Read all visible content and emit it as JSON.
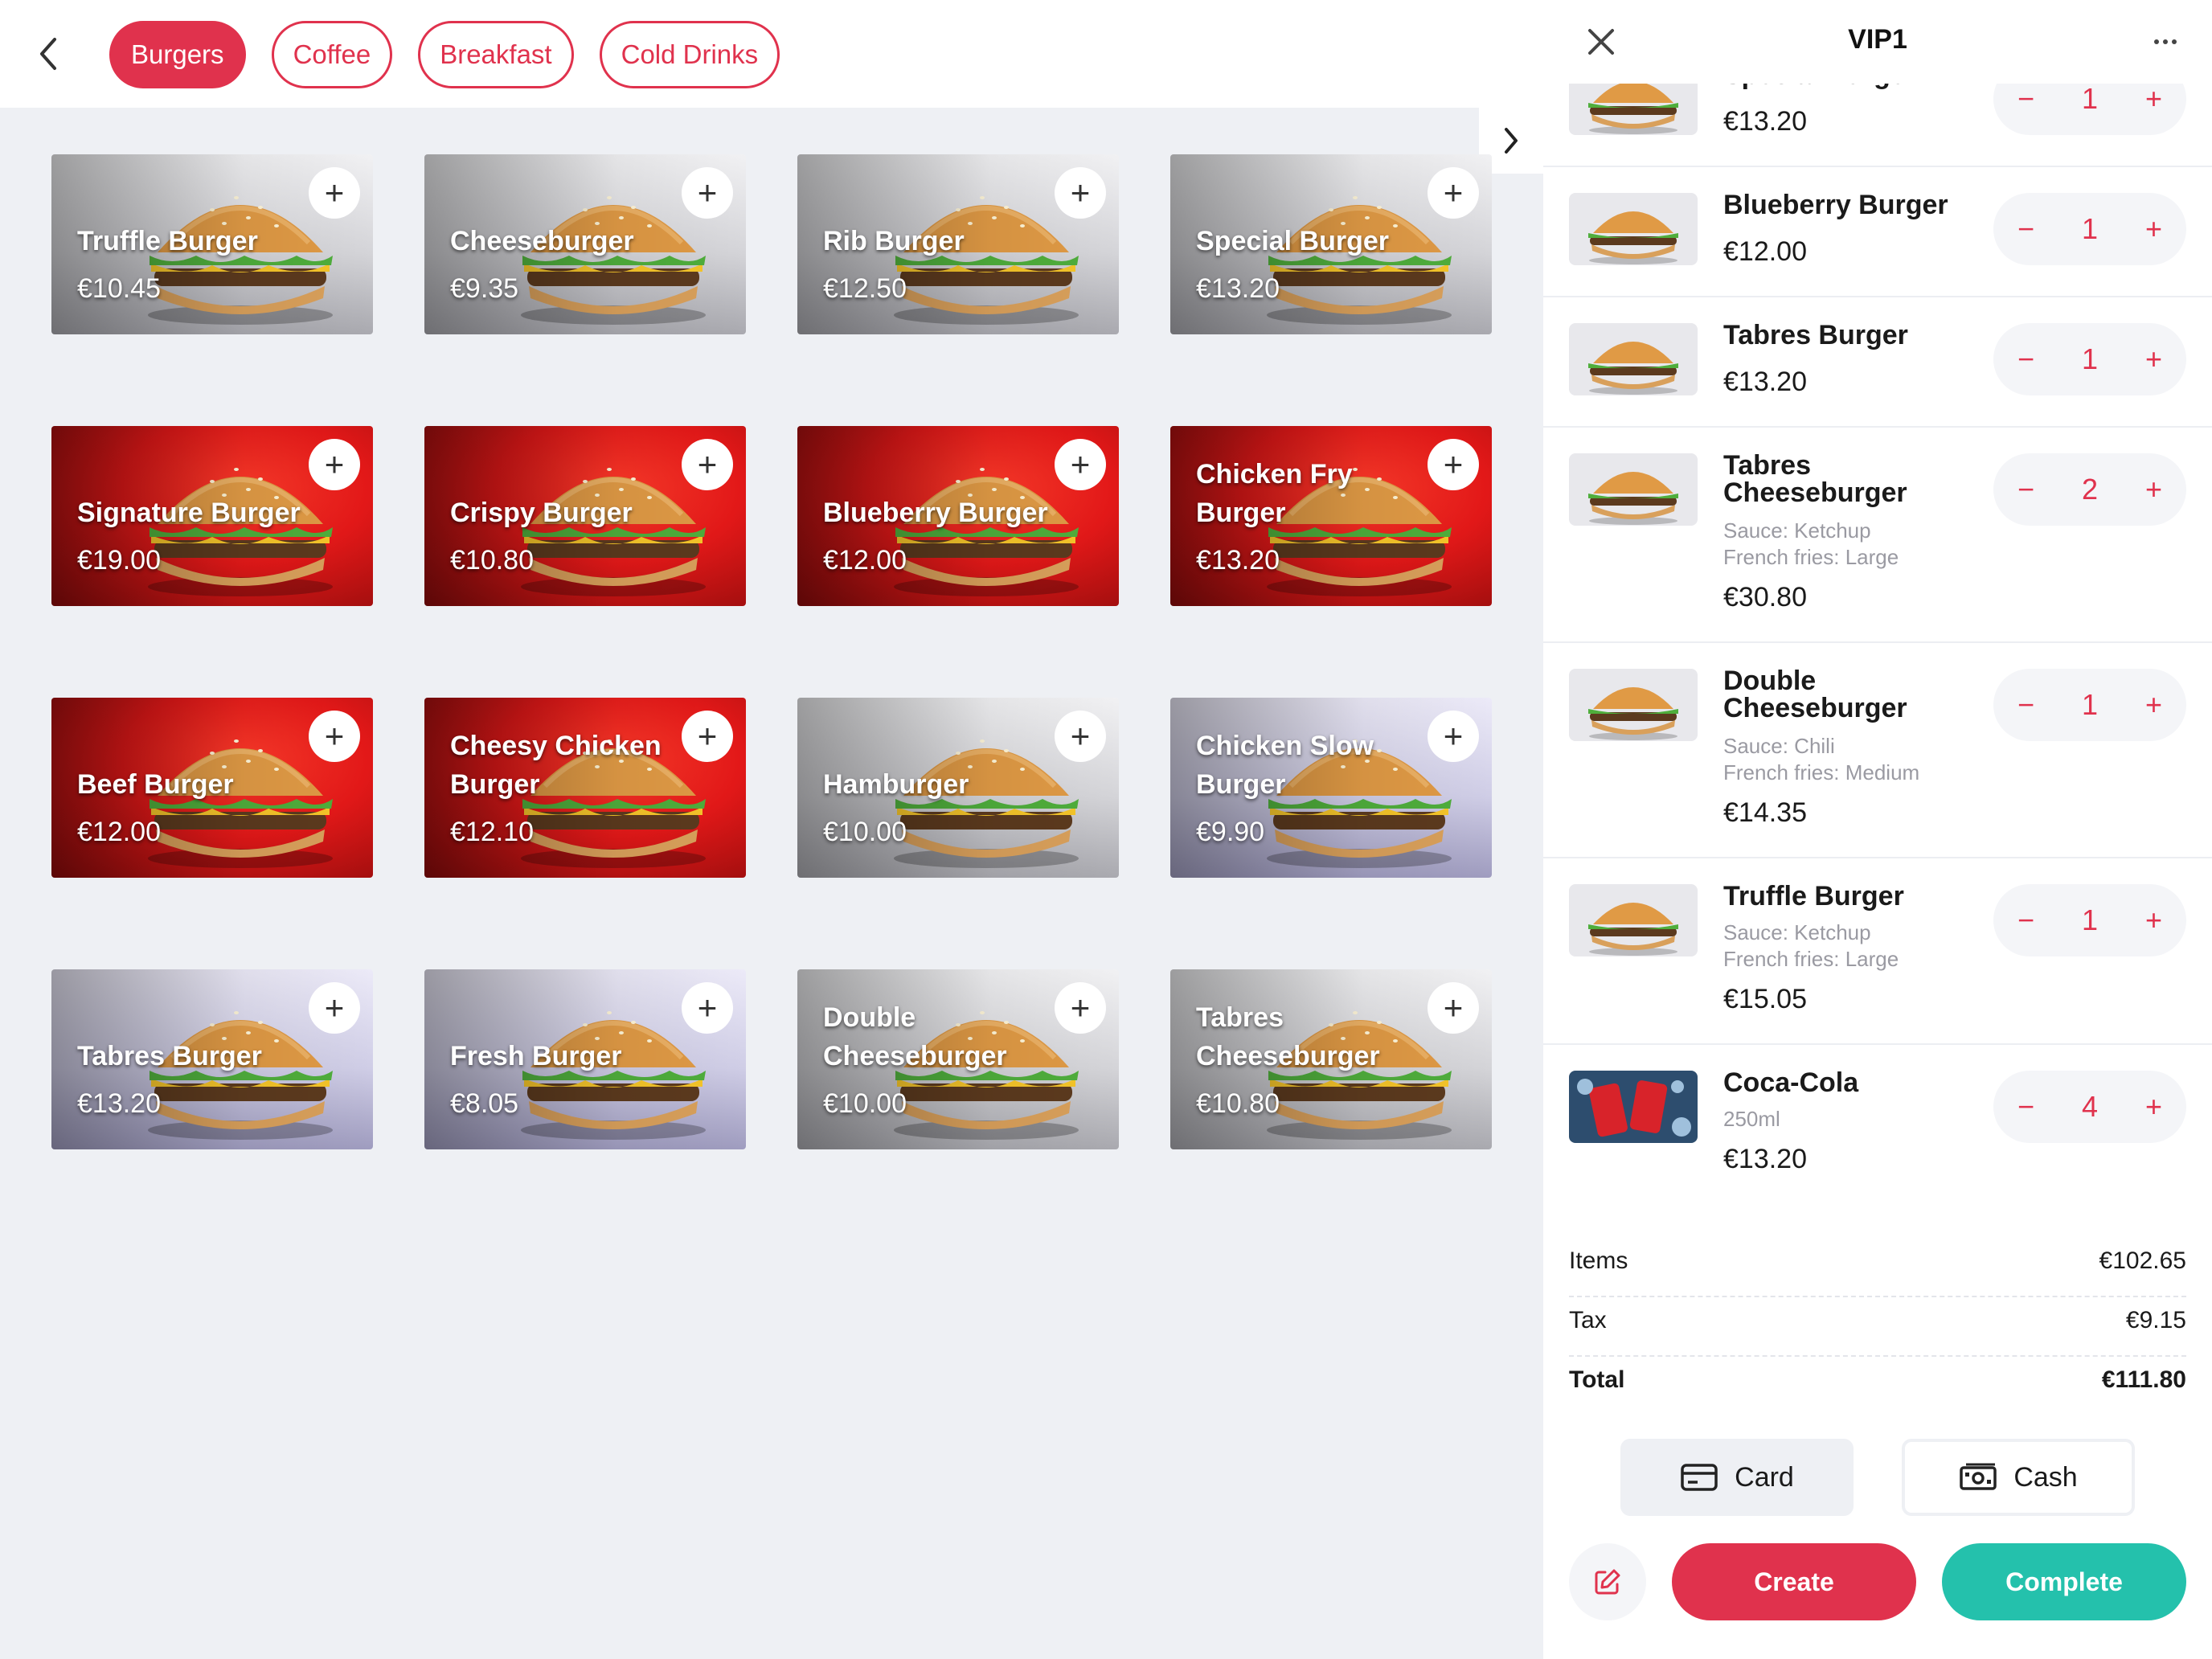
{
  "categories": [
    "Burgers",
    "Coffee",
    "Breakfast",
    "Cold Drinks"
  ],
  "active_category": "Burgers",
  "products": [
    {
      "name": "Truffle Burger",
      "price": "€10.45",
      "bg": "grey"
    },
    {
      "name": "Cheeseburger",
      "price": "€9.35",
      "bg": "grey"
    },
    {
      "name": "Rib Burger",
      "price": "€12.50",
      "bg": "grey"
    },
    {
      "name": "Special Burger",
      "price": "€13.20",
      "bg": "grey"
    },
    {
      "name": "Signature Burger",
      "price": "€19.00",
      "bg": "red"
    },
    {
      "name": "Crispy Burger",
      "price": "€10.80",
      "bg": "red"
    },
    {
      "name": "Blueberry Burger",
      "price": "€12.00",
      "bg": "red"
    },
    {
      "name": "Chicken Fry Burger",
      "price": "€13.20",
      "bg": "red"
    },
    {
      "name": "Beef Burger",
      "price": "€12.00",
      "bg": "red"
    },
    {
      "name": "Cheesy Chicken Burger",
      "price": "€12.10",
      "bg": "red"
    },
    {
      "name": "Hamburger",
      "price": "€10.00",
      "bg": "grey"
    },
    {
      "name": "Chicken Slow Burger",
      "price": "€9.90",
      "bg": "lav"
    },
    {
      "name": "Tabres Burger",
      "price": "€13.20",
      "bg": "lav"
    },
    {
      "name": "Fresh Burger",
      "price": "€8.05",
      "bg": "lav"
    },
    {
      "name": "Double Cheeseburger",
      "price": "€10.00",
      "bg": "grey"
    },
    {
      "name": "Tabres Cheeseburger",
      "price": "€10.80",
      "bg": "grey"
    }
  ],
  "order": {
    "title": "VIP1",
    "items": [
      {
        "name": "Special Burger",
        "details": [],
        "price": "€13.20",
        "qty": "1"
      },
      {
        "name": "Blueberry Burger",
        "details": [],
        "price": "€12.00",
        "qty": "1"
      },
      {
        "name": "Tabres Burger",
        "details": [],
        "price": "€13.20",
        "qty": "1"
      },
      {
        "name": "Tabres Cheeseburger",
        "details": [
          "Sauce: Ketchup",
          "French fries: Large"
        ],
        "price": "€30.80",
        "qty": "2"
      },
      {
        "name": "Double Cheeseburger",
        "details": [
          "Sauce: Chili",
          "French fries: Medium"
        ],
        "price": "€14.35",
        "qty": "1"
      },
      {
        "name": "Truffle Burger",
        "details": [
          "Sauce: Ketchup",
          "French fries: Large"
        ],
        "price": "€15.05",
        "qty": "1"
      },
      {
        "name": "Coca-Cola",
        "details": [
          "250ml"
        ],
        "price": "€13.20",
        "qty": "4"
      }
    ]
  },
  "totals": {
    "items_label": "Items",
    "items_value": "€102.65",
    "tax_label": "Tax",
    "tax_value": "€9.15",
    "total_label": "Total",
    "total_value": "€111.80"
  },
  "payment": {
    "card_label": "Card",
    "cash_label": "Cash"
  },
  "actions": {
    "create_label": "Create",
    "complete_label": "Complete"
  },
  "colors": {
    "accent": "#e0324d",
    "complete": "#24c1ac",
    "background": "#eef0f4"
  }
}
